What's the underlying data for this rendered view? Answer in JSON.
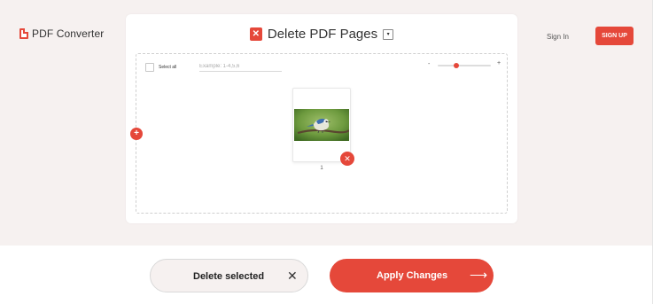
{
  "header": {
    "logo_text": "PDF Converter",
    "signin_label": "Sign In",
    "signup_label": "SIGN UP"
  },
  "tool": {
    "title": "Delete PDF Pages",
    "title_icon_glyph": "✕",
    "dropdown_glyph": "▾"
  },
  "toolbar": {
    "select_all_label": "Select all",
    "range_placeholder": "Example: 1-4,5,6",
    "zoom_minus": "-",
    "zoom_plus": "+",
    "zoom_level": 0.35
  },
  "add_page_glyph": "+",
  "pages": [
    {
      "number": "1",
      "thumbnail": "bird-on-branch-photo",
      "delete_glyph": "✕"
    }
  ],
  "actions": {
    "delete_selected_label": "Delete selected",
    "delete_selected_icon": "✕",
    "apply_label": "Apply Changes",
    "apply_icon": "⟶"
  },
  "colors": {
    "accent": "#e5483a",
    "background": "#f6f1f0"
  }
}
